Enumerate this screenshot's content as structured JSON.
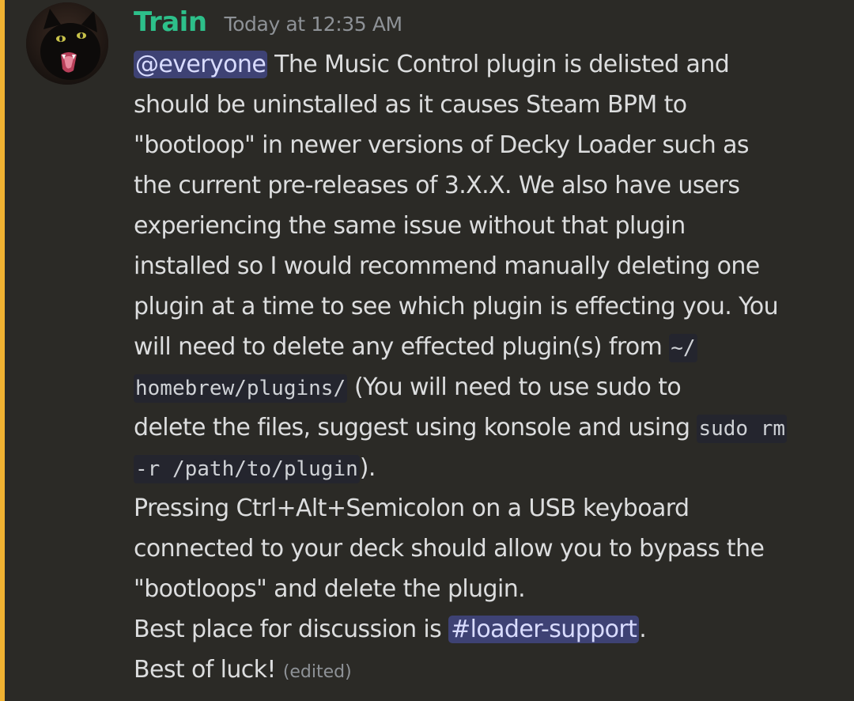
{
  "message": {
    "author": "Train",
    "timestamp": "Today at 12:35 AM",
    "author_color": "#2dc08a",
    "mention_highlight_color": "#f0b232",
    "avatar_icon": "black-cat-avatar",
    "lines": {
      "l1": {
        "mention": "@everyone",
        "text": " The Music Control plugin is delisted and"
      },
      "l2": "should be uninstalled as it causes Steam BPM to",
      "l3": "\"bootloop\" in newer versions of Decky Loader such as",
      "l4": "the current pre-releases of 3.X.X. We also have users",
      "l5": "experiencing the same issue without that plugin",
      "l6": "installed so I would recommend manually deleting one",
      "l7": "plugin at a time to see which plugin is effecting you. You",
      "l8": {
        "text": "will need to delete any effected plugin(s) from ",
        "code": "~/"
      },
      "l9": {
        "code": "homebrew/plugins/",
        "text": " (You will need to use sudo to"
      },
      "l10": {
        "text": "delete the files, suggest using konsole and using ",
        "code": "sudo rm"
      },
      "l11": {
        "code": "-r /path/to/plugin",
        "text": ")."
      },
      "l12": "Pressing Ctrl+Alt+Semicolon on a USB keyboard",
      "l13": "connected to your deck should allow you to bypass the",
      "l14": "\"bootloops\" and delete the plugin.",
      "l15": {
        "text": "Best place for discussion is ",
        "channel": "#loader-support",
        "after": "."
      },
      "l16": {
        "text": "Best of luck! ",
        "edited": "(edited)"
      }
    }
  }
}
